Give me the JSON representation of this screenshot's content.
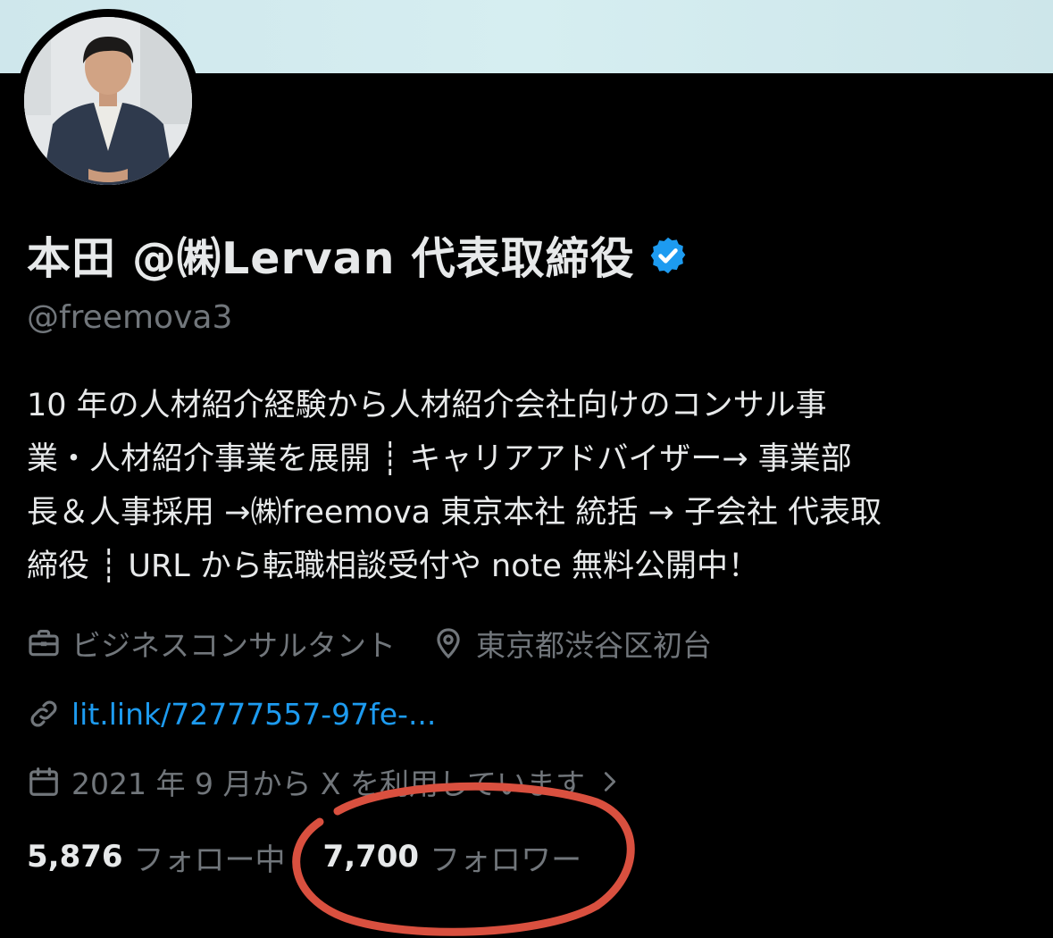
{
  "profile": {
    "display_name": "本田 @㈱Lervan 代表取締役",
    "handle": "@freemova3",
    "bio_lines": [
      "10 年の人材紹介経験から人材紹介会社向けのコンサル事",
      "業・人材紹介事業を展開 ┊ キャリアアドバイザー→ 事業部",
      "長＆人事採用 →㈱freemova 東京本社 統括 → 子会社 代表取",
      "締役 ┊ URL から転職相談受付や note 無料公開中！"
    ],
    "category": "ビジネスコンサルタント",
    "location": "東京都渋谷区初台",
    "link": "lit.link/72777557-97fe-...",
    "joined": "2021 年 9 月から X を利用しています",
    "following_count": "5,876",
    "following_label": "フォロー中",
    "followers_count": "7,700",
    "followers_label": "フォロワー"
  },
  "icons": {
    "verified": "verified-badge-icon",
    "category": "briefcase-icon",
    "location": "location-pin-icon",
    "link": "link-icon",
    "joined": "calendar-icon",
    "more": "chevron-right-icon"
  },
  "colors": {
    "background": "#000000",
    "text_primary": "#e7e9ea",
    "text_secondary": "#71767b",
    "link": "#1d9bf0",
    "verified": "#1d9bf0",
    "annotation": "#d9503f"
  }
}
